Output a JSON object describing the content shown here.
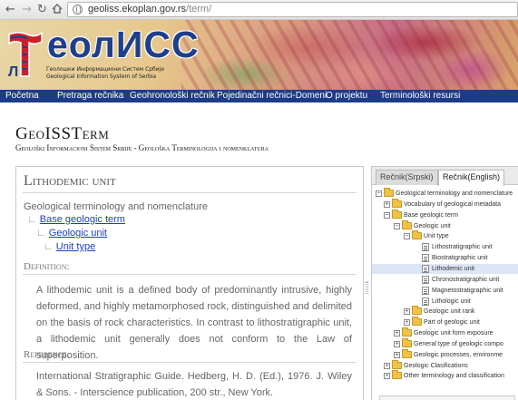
{
  "browser": {
    "url_host": "geoliss.ekoplan.gov.rs",
    "url_path": "/term/"
  },
  "banner": {
    "logo_text": "еолИСС",
    "logo_subtitle_1": "Геолошки Информациони Систем Србије",
    "logo_subtitle_2": "Geological Information System of Serbia",
    "map_glyph": "Л"
  },
  "menu": {
    "items": [
      "Početna",
      "Pretraga rečnika",
      "Geohronološki rečnik",
      "Pojedinačni rečnici-Domeni",
      "O projektu",
      "Terminološki resursi"
    ]
  },
  "page": {
    "title": "GeoISSTerm",
    "subtitle": "Geološki Informacioni Sistem Srbije - Geološka Terminologija i nomenklatura"
  },
  "term": {
    "title": "Lithodemic unit",
    "breadcrumb_root": "Geological terminology and nomenclature",
    "breadcrumb": [
      "Base geologic term",
      "Geologic unit",
      "Unit type"
    ],
    "definition_label": "Definition:",
    "definition": "A lithodemic unit is a defined body of predominantly intrusive, highly deformed, and highly metamorphosed rock, distinguished and delimited on the basis of rock characteristics. In contrast to lithostratigraphic unit, a lithodemic unit generally does not conform to the Law of superposition.",
    "reference_label": "Reference:",
    "reference": "International Stratigraphic Guide. Hedberg, H. D. (Ed.), 1976. J. Wiley & Sons. - Interscience publication, 200 str., New York."
  },
  "tree": {
    "tabs": [
      "Rečnik(Srpski)",
      "Rečnik(English)"
    ],
    "active_tab": "Rečnik(English)",
    "nodes": [
      {
        "label": "Geological terminology and nomenclature",
        "depth": 0,
        "type": "folder",
        "toggle": "−"
      },
      {
        "label": "Vocabulary of geological metadata",
        "depth": 1,
        "type": "folder",
        "toggle": "+"
      },
      {
        "label": "Base geologic term",
        "depth": 1,
        "type": "folder",
        "toggle": "−"
      },
      {
        "label": "Geologic unit",
        "depth": 2,
        "type": "folder",
        "toggle": "−"
      },
      {
        "label": "Unit type",
        "depth": 3,
        "type": "folder",
        "toggle": "−"
      },
      {
        "label": "Lithostratigraphic unit",
        "depth": 4,
        "type": "doc"
      },
      {
        "label": "Biostratigraphic unit",
        "depth": 4,
        "type": "doc"
      },
      {
        "label": "Lithodemic unit",
        "depth": 4,
        "type": "doc",
        "selected": true
      },
      {
        "label": "Chronostratigraphic unit",
        "depth": 4,
        "type": "doc"
      },
      {
        "label": "Magnetostratigraphic unit",
        "depth": 4,
        "type": "doc"
      },
      {
        "label": "Lithologic unit",
        "depth": 4,
        "type": "doc"
      },
      {
        "label": "Geologic unit rank",
        "depth": 3,
        "type": "folder",
        "toggle": "+"
      },
      {
        "label": "Part of geologic unit",
        "depth": 3,
        "type": "folder",
        "toggle": "+"
      },
      {
        "label": "Geologic unit form exposure",
        "depth": 2,
        "type": "folder",
        "toggle": "+"
      },
      {
        "label": "General type of geologic compo",
        "depth": 2,
        "type": "folder",
        "toggle": "+"
      },
      {
        "label": "Geologic processes, environme",
        "depth": 2,
        "type": "folder",
        "toggle": "+"
      },
      {
        "label": "Geologic Clasifications",
        "depth": 1,
        "type": "folder",
        "toggle": "+"
      },
      {
        "label": "Other terminology and classification",
        "depth": 1,
        "type": "folder",
        "toggle": "+"
      }
    ]
  }
}
